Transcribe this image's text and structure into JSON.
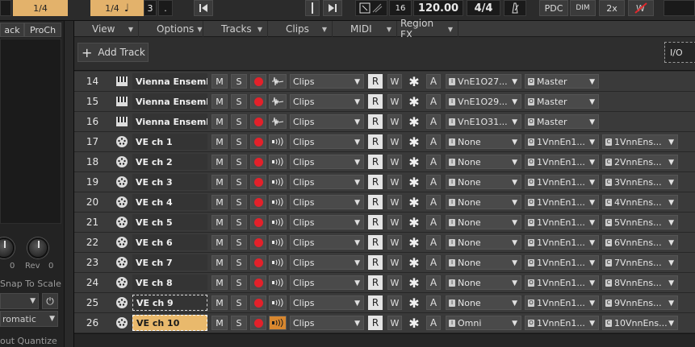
{
  "topbar": {
    "signature_left": "1/4",
    "signature_right": "1/4",
    "note_glyph": "♩",
    "quantize_value": "3",
    "dot": ".",
    "position_value": "16",
    "tempo": "120.00",
    "time_sig": "4/4",
    "pdc": "PDC",
    "dim": "DIM",
    "zoom": "2x"
  },
  "left_panel": {
    "tab1": "ack",
    "tab2": "ProCh",
    "knob1_value": "0",
    "knob2_label": "Rev",
    "knob2_value": "0",
    "snap_label": "Snap To Scale",
    "scale_value": "romatic",
    "quantize_label": "out Quantize"
  },
  "menubar": [
    {
      "label": "View"
    },
    {
      "label": "Options"
    },
    {
      "label": "Tracks"
    },
    {
      "label": "Clips"
    },
    {
      "label": "MIDI"
    },
    {
      "label": "Region FX"
    }
  ],
  "toolbar": {
    "add_track": "Add Track",
    "io": "I/O"
  },
  "labels": {
    "mute": "M",
    "solo": "S",
    "read": "R",
    "write": "W",
    "arm_auto": "A",
    "clips": "Clips"
  },
  "tracks": [
    {
      "num": "14",
      "name": "Vienna Ensemble",
      "type": "instrument",
      "input": "VnE1O27...",
      "output": "Master",
      "output2": ""
    },
    {
      "num": "15",
      "name": "Vienna Ensemble",
      "type": "instrument",
      "input": "VnE1O29...",
      "output": "Master",
      "output2": ""
    },
    {
      "num": "16",
      "name": "Vienna Ensemble",
      "type": "instrument",
      "input": "VnE1O31...",
      "output": "Master",
      "output2": ""
    },
    {
      "num": "17",
      "name": "VE ch 1",
      "type": "midi",
      "input": "None",
      "output": "1VnnEn1...",
      "output2": "1VnnEns..."
    },
    {
      "num": "18",
      "name": "VE ch 2",
      "type": "midi",
      "input": "None",
      "output": "1VnnEn1...",
      "output2": "2VnnEns..."
    },
    {
      "num": "19",
      "name": "VE ch 3",
      "type": "midi",
      "input": "None",
      "output": "1VnnEn1...",
      "output2": "3VnnEns..."
    },
    {
      "num": "20",
      "name": "VE ch 4",
      "type": "midi",
      "input": "None",
      "output": "1VnnEn1...",
      "output2": "4VnnEns..."
    },
    {
      "num": "21",
      "name": "VE ch 5",
      "type": "midi",
      "input": "None",
      "output": "1VnnEn1...",
      "output2": "5VnnEns..."
    },
    {
      "num": "22",
      "name": "VE ch 6",
      "type": "midi",
      "input": "None",
      "output": "1VnnEn1...",
      "output2": "6VnnEns..."
    },
    {
      "num": "23",
      "name": "VE ch 7",
      "type": "midi",
      "input": "None",
      "output": "1VnnEn1...",
      "output2": "7VnnEns..."
    },
    {
      "num": "24",
      "name": "VE ch 8",
      "type": "midi",
      "input": "None",
      "output": "1VnnEn1...",
      "output2": "8VnnEns..."
    },
    {
      "num": "25",
      "name": "VE ch 9",
      "type": "midi",
      "input": "None",
      "output": "1VnnEn1...",
      "output2": "9VnnEns..."
    },
    {
      "num": "26",
      "name": "VE ch 10",
      "type": "midi",
      "input": "Omni",
      "output": "1VnnEn1...",
      "output2": "10VnnEns..."
    }
  ],
  "colors": {
    "selected_track": "#e9b96c",
    "record": "#e3212a",
    "monitor_on": "#d8872f",
    "accent": "#e3b26b"
  }
}
